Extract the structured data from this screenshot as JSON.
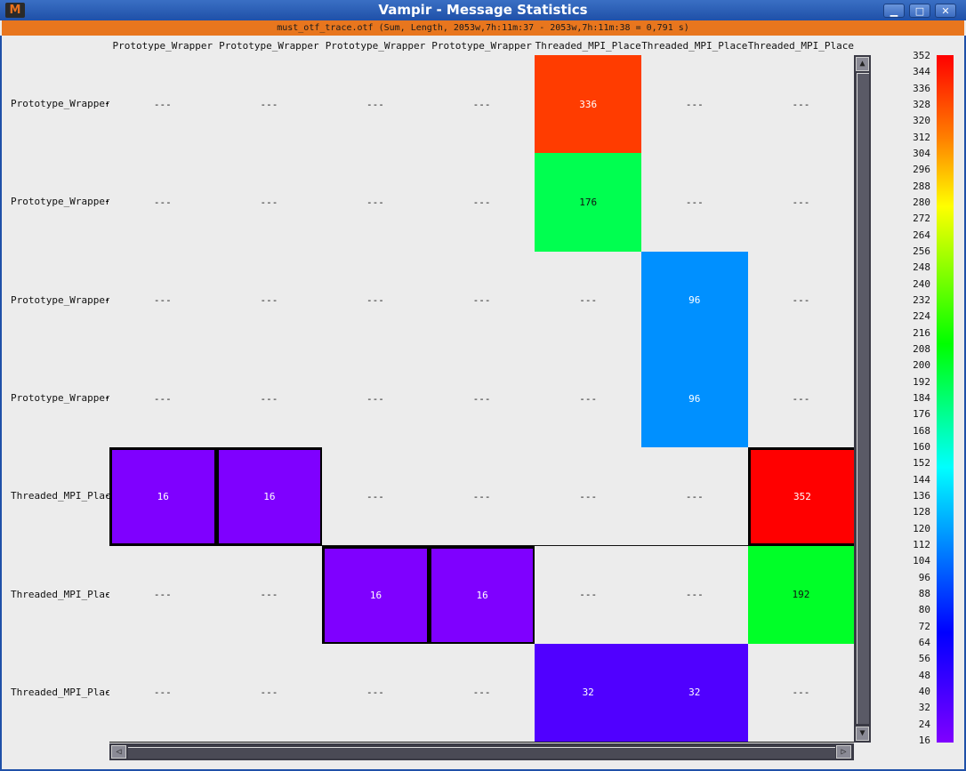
{
  "window": {
    "title": "Vampir - Message Statistics",
    "app_icon_glyph": "M",
    "buttons": {
      "minimize": "▁",
      "maximize": "□",
      "close": "✕"
    }
  },
  "subtitle": "must_otf_trace.otf (Sum, Length, 2053w,7h:11m:37 - 2053w,7h:11m:38 = 0,791 s)",
  "columns": [
    "Prototype_Wrapper",
    "Prototype_Wrapper",
    "Prototype_Wrapper",
    "Prototype_Wrapper",
    "Threaded_MPI_Place",
    "Threaded_MPI_Place",
    "Threaded_MPI_Place"
  ],
  "rows": [
    "Prototype_Wrapper",
    "Prototype_Wrapper",
    "Prototype_Wrapper",
    "Prototype_Wrapper",
    "Threaded_MPI_Place",
    "Threaded_MPI_Place",
    "Threaded_MPI_Place"
  ],
  "empty_text": "---",
  "matrix": [
    [
      "---",
      "---",
      "---",
      "---",
      "336",
      "---",
      "---"
    ],
    [
      "---",
      "---",
      "---",
      "---",
      "176",
      "---",
      "---"
    ],
    [
      "---",
      "---",
      "---",
      "---",
      "---",
      "96",
      "---"
    ],
    [
      "---",
      "---",
      "---",
      "---",
      "---",
      "96",
      "---"
    ],
    [
      "16",
      "16",
      "---",
      "---",
      "---",
      "---",
      "352"
    ],
    [
      "---",
      "---",
      "16",
      "16",
      "---",
      "---",
      "192"
    ],
    [
      "---",
      "---",
      "---",
      "---",
      "32",
      "32",
      "---"
    ]
  ],
  "highlighted": [
    [
      4,
      0
    ],
    [
      4,
      1
    ],
    [
      4,
      6
    ],
    [
      5,
      2
    ],
    [
      5,
      3
    ]
  ],
  "colors": {
    "empty": "#ececec",
    "16": "#7f00ff",
    "32": "#5000ff",
    "96": "#0090ff",
    "176": "#00ff50",
    "192": "#00ff28",
    "336": "#ff3c00",
    "352": "#ff0000"
  },
  "text_colors": {
    "dark_bg": "#ffffff",
    "light_bg": "#111111"
  },
  "legend": {
    "labels": [
      "352",
      "344",
      "336",
      "328",
      "320",
      "312",
      "304",
      "296",
      "288",
      "280",
      "272",
      "264",
      "256",
      "248",
      "240",
      "232",
      "224",
      "216",
      "208",
      "200",
      "192",
      "184",
      "176",
      "168",
      "160",
      "152",
      "144",
      "136",
      "128",
      "120",
      "112",
      "104",
      "96",
      "88",
      "80",
      "72",
      "64",
      "56",
      "48",
      "40",
      "32",
      "24",
      "16"
    ]
  },
  "scrollbars": {
    "up": "▲",
    "down": "▼",
    "left": "◁",
    "right": "▷"
  }
}
